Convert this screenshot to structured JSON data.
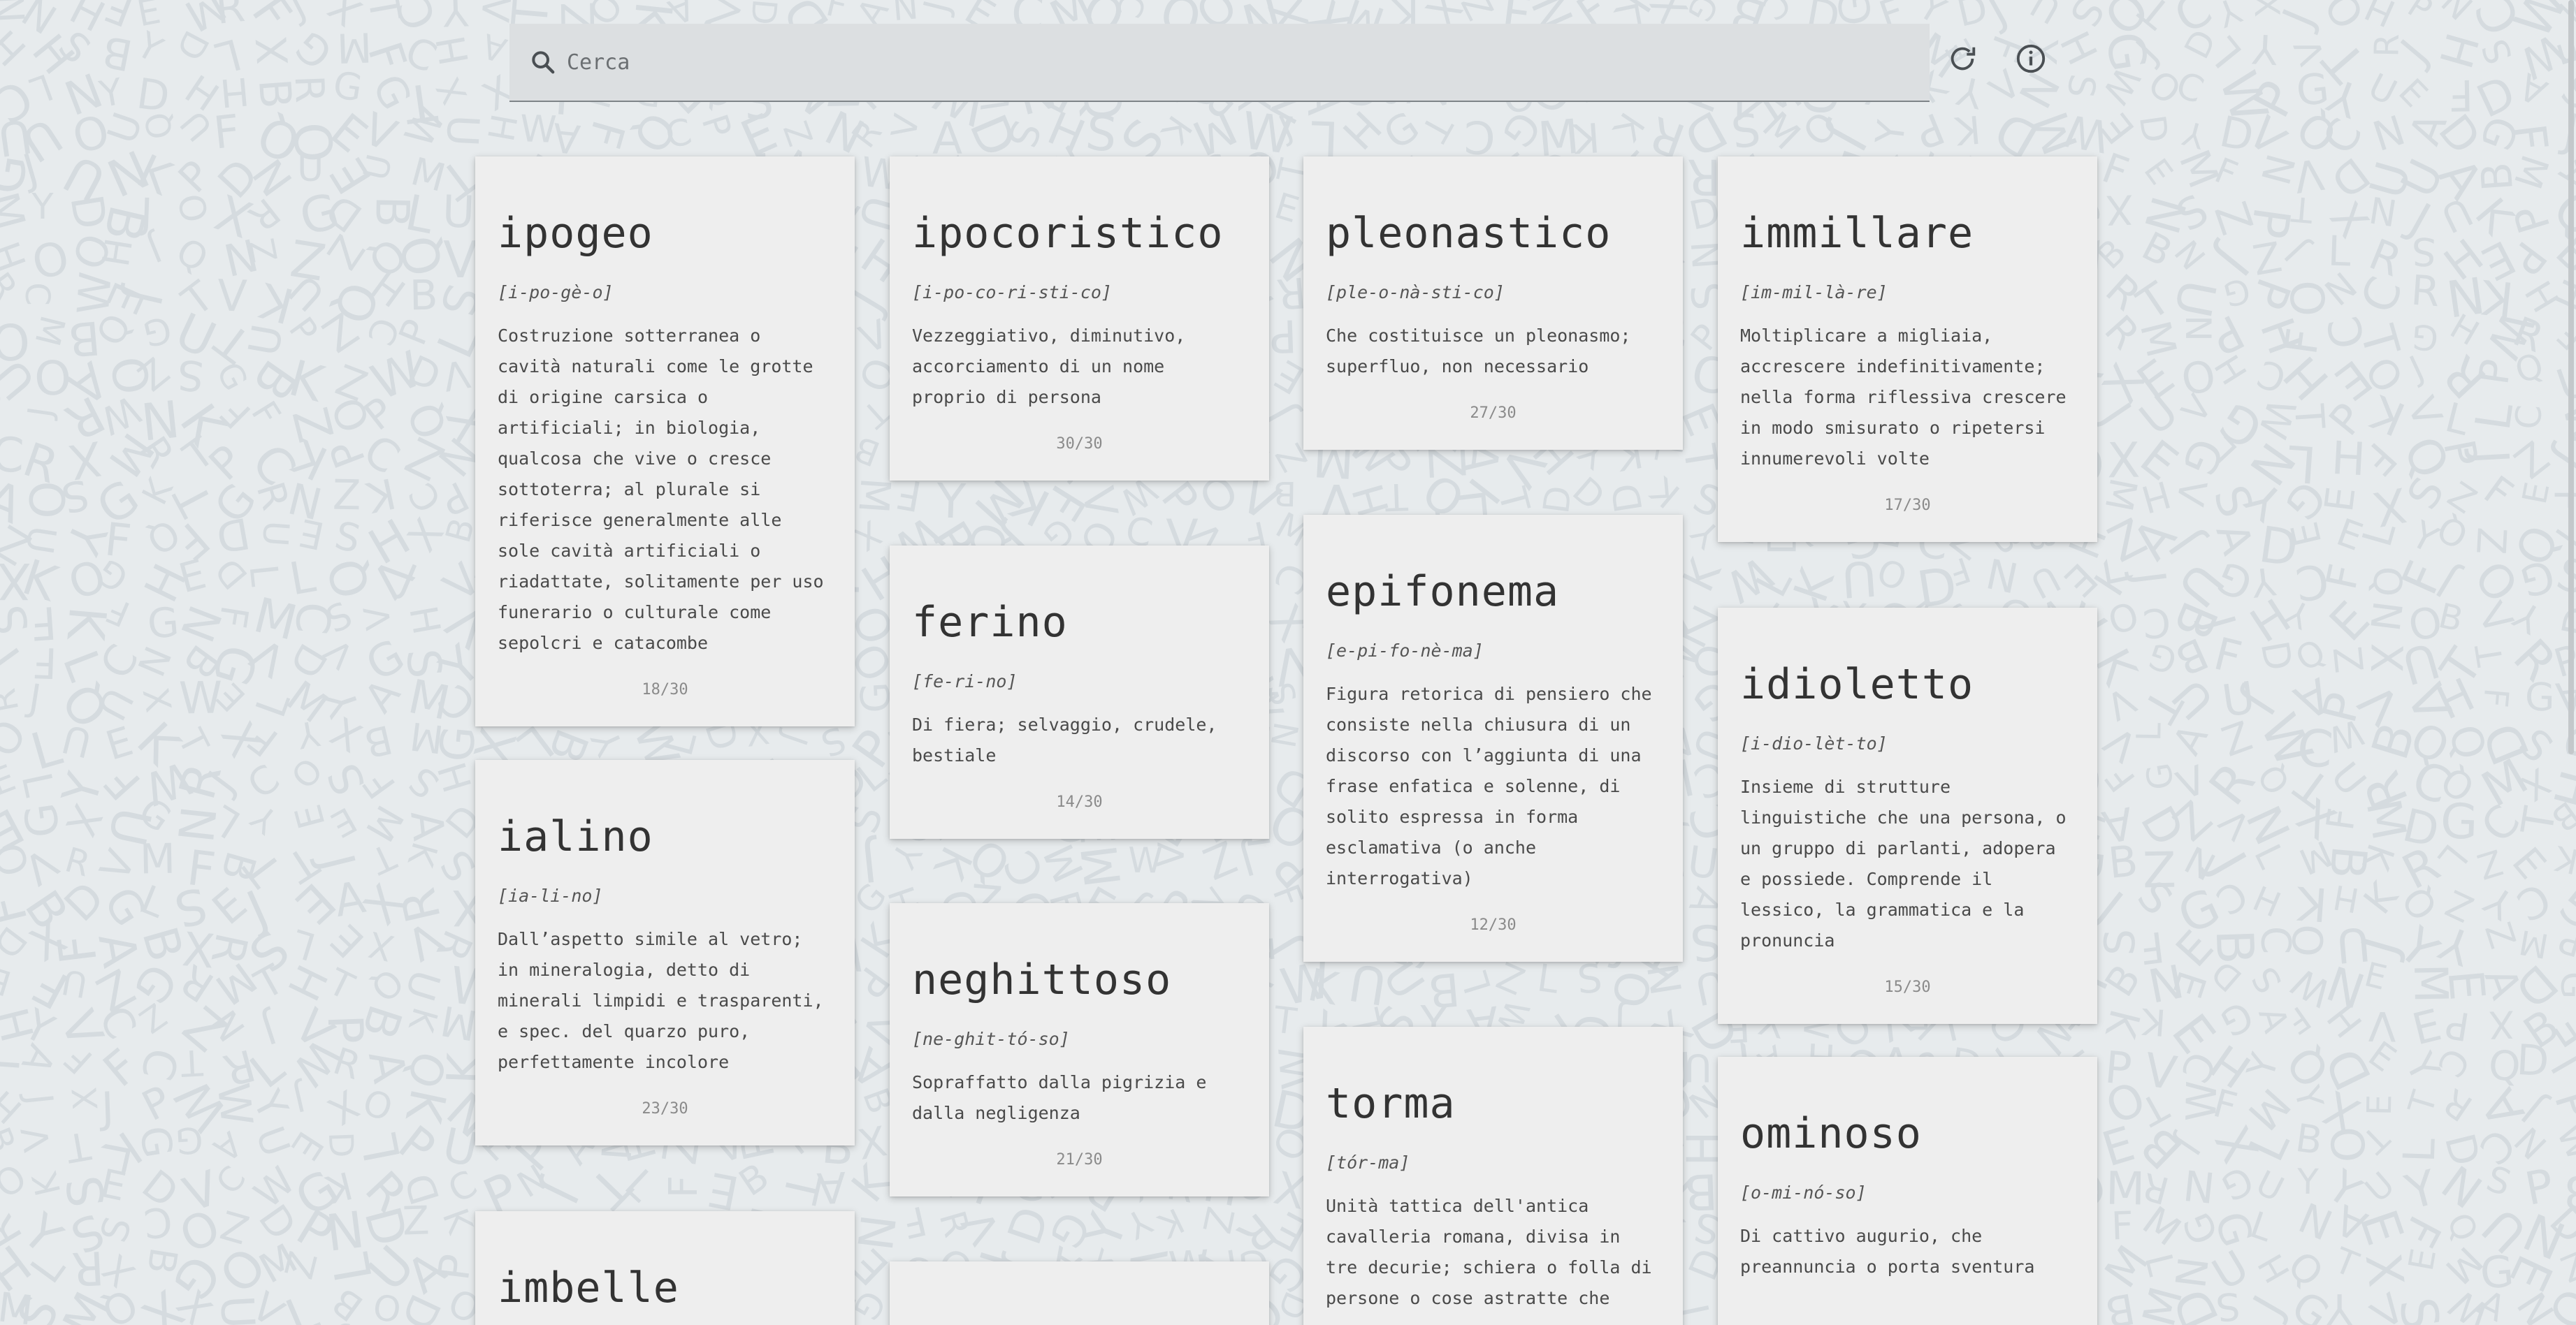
{
  "search": {
    "placeholder": "Cerca",
    "value": ""
  },
  "toolbar": {
    "refresh_icon": "refresh-icon",
    "info_icon": "info-icon"
  },
  "columns": [
    [
      {
        "word": "ipogeo",
        "syllables": "[i-po-gè-o]",
        "definition": "Costruzione sotterranea o cavità naturali come le grotte di origine carsica o artificiali; in biologia, qualcosa che vive o cresce sottoterra; al plurale si riferisce generalmente alle sole cavità artificiali o riadattate, solitamente per uso funerario o culturale come sepolcri e catacombe",
        "count": "18/30"
      },
      {
        "word": "ialino",
        "syllables": "[ia-li-no]",
        "definition": "Dall’aspetto simile al vetro; in mineralogia, detto di minerali limpidi e trasparenti, e spec. del quarzo puro, perfettamente incolore",
        "count": "23/30"
      },
      {
        "word": "imbelle",
        "syllables": "",
        "definition": "",
        "count": ""
      }
    ],
    [
      {
        "word": "ipocoristico",
        "syllables": "[i-po-co-ri-sti-co]",
        "definition": "Vezzeggiativo, diminutivo, accorciamento di un nome proprio di persona",
        "count": "30/30"
      },
      {
        "word": "ferino",
        "syllables": "[fe-ri-no]",
        "definition": "Di fiera; selvaggio, crudele, bestiale",
        "count": "14/30"
      },
      {
        "word": "neghittoso",
        "syllables": "[ne-ghit-tó-so]",
        "definition": "Sopraffatto dalla pigrizia e dalla negligenza",
        "count": "21/30"
      },
      {
        "word": "",
        "syllables": "",
        "definition": "",
        "count": ""
      }
    ],
    [
      {
        "word": "pleonastico",
        "syllables": "[ple-o-nà-sti-co]",
        "definition": "Che costituisce un pleonasmo; superfluo, non necessario",
        "count": "27/30"
      },
      {
        "word": "epifonema",
        "syllables": "[e-pi-fo-nè-ma]",
        "definition": "Figura retorica di pensiero che consiste nella chiusura di un discorso con l’aggiunta di una frase enfatica e solenne, di solito espressa in forma esclamativa (o anche interrogativa)",
        "count": "12/30"
      },
      {
        "word": "torma",
        "syllables": "[tór-ma]",
        "definition": "Unità tattica dell'antica cavalleria romana, divisa in tre decurie; schiera o folla di persone o cose astratte che",
        "count": ""
      }
    ],
    [
      {
        "word": "immillare",
        "syllables": "[im-mil-là-re]",
        "definition": "Moltiplicare a migliaia, accrescere indefinitivamente; nella forma riflessiva crescere in modo smisurato o ripetersi innumerevoli volte",
        "count": "17/30"
      },
      {
        "word": "idioletto",
        "syllables": "[i-dio-lèt-to]",
        "definition": "Insieme di strutture linguistiche che una persona, o un gruppo di parlanti, adopera e possiede. Comprende il lessico, la grammatica e la pronuncia",
        "count": "15/30"
      },
      {
        "word": "ominoso",
        "syllables": "[o-mi-nó-so]",
        "definition": "Di cattivo augurio, che preannuncia o porta sventura",
        "count": ""
      }
    ]
  ]
}
